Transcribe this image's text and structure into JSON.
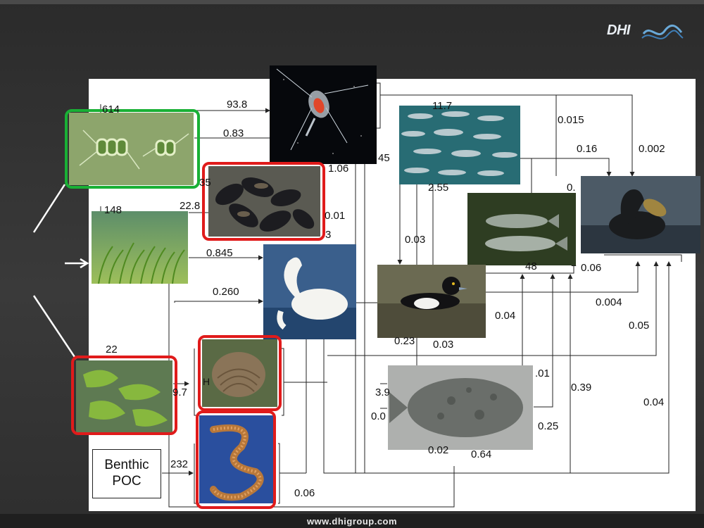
{
  "footer": {
    "url": "www.dhigroup.com"
  },
  "logo": {
    "text": "DHI"
  },
  "benthic_box": {
    "line1": "Benthic",
    "line2": "POC"
  },
  "flow_labels": [
    {
      "id": "f-614",
      "text": "614"
    },
    {
      "id": "f-93-8",
      "text": "93.8"
    },
    {
      "id": "f-0-83",
      "text": "0.83"
    },
    {
      "id": "f-11-7",
      "text": "11.7"
    },
    {
      "id": "f-0-015",
      "text": "0.015"
    },
    {
      "id": "f-0-16",
      "text": "0.16"
    },
    {
      "id": "f-0-002",
      "text": "0.002"
    },
    {
      "id": "f-45",
      "text": "45"
    },
    {
      "id": "f-1-06",
      "text": "1.06"
    },
    {
      "id": "f-2-55",
      "text": "2.55"
    },
    {
      "id": "f-0-x",
      "text": "0."
    },
    {
      "id": "f-148",
      "text": "148"
    },
    {
      "id": "f-22-8",
      "text": "22.8"
    },
    {
      "id": "f-35",
      "text": "35"
    },
    {
      "id": "f-0-01",
      "text": "0.01"
    },
    {
      "id": "f-3",
      "text": "3"
    },
    {
      "id": "f-0-03a",
      "text": "0.03"
    },
    {
      "id": "f-0-845",
      "text": "0.845"
    },
    {
      "id": "f-48",
      "text": "48"
    },
    {
      "id": "f-0-06a",
      "text": "0.06"
    },
    {
      "id": "f-0-260",
      "text": "0.260"
    },
    {
      "id": "f-0-004",
      "text": "0.004"
    },
    {
      "id": "f-0-04a",
      "text": "0.04"
    },
    {
      "id": "f-0-05",
      "text": "0.05"
    },
    {
      "id": "f-0-23",
      "text": "0.23"
    },
    {
      "id": "f-0-03b",
      "text": "0.03"
    },
    {
      "id": "f-22",
      "text": "22"
    },
    {
      "id": "f-01",
      "text": ".01"
    },
    {
      "id": "f-9-7",
      "text": "9.7"
    },
    {
      "id": "f-3-9",
      "text": "3.9"
    },
    {
      "id": "f-0-39",
      "text": "0.39"
    },
    {
      "id": "f-0-04b",
      "text": "0.04"
    },
    {
      "id": "f-0-0",
      "text": "0.0"
    },
    {
      "id": "f-0-25",
      "text": "0.25"
    },
    {
      "id": "f-0-02",
      "text": "0.02"
    },
    {
      "id": "f-0-64",
      "text": "0.64"
    },
    {
      "id": "f-232",
      "text": "232"
    },
    {
      "id": "f-0-06b",
      "text": "0.06"
    },
    {
      "id": "f-h",
      "text": "H"
    }
  ],
  "photos": [
    {
      "id": "diatom",
      "icon": "diatom-photo",
      "frame": "green"
    },
    {
      "id": "copepod",
      "icon": "copepod-photo",
      "frame": "none"
    },
    {
      "id": "herring",
      "icon": "herring-school-photo",
      "frame": "none"
    },
    {
      "id": "mussels",
      "icon": "mussel-bed-photo",
      "frame": "red"
    },
    {
      "id": "eelgrass",
      "icon": "eelgrass-photo",
      "frame": "none"
    },
    {
      "id": "trout",
      "icon": "trout-photo",
      "frame": "none"
    },
    {
      "id": "cormorant",
      "icon": "cormorant-photo",
      "frame": "none"
    },
    {
      "id": "swan",
      "icon": "swan-photo",
      "frame": "none"
    },
    {
      "id": "tufted-duck",
      "icon": "tufted-duck-photo",
      "frame": "none"
    },
    {
      "id": "sea-lettuce",
      "icon": "ulva-photo",
      "frame": "red"
    },
    {
      "id": "clam",
      "icon": "clam-photo",
      "frame": "red"
    },
    {
      "id": "flounder",
      "icon": "flounder-photo",
      "frame": "none"
    },
    {
      "id": "polychaete",
      "icon": "polychaete-worm-photo",
      "frame": "red"
    }
  ],
  "colors": {
    "background": "#333333",
    "panel": "#ffffff",
    "frame_red": "#e01b1b",
    "frame_green": "#19b035",
    "lines": "#222222"
  }
}
